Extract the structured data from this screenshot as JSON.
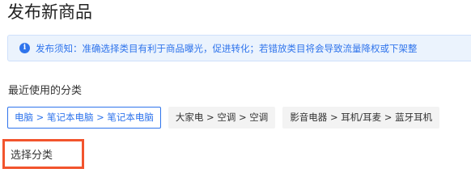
{
  "page": {
    "title": "发布新商品"
  },
  "notice": {
    "icon": "info-icon",
    "icon_glyph": "i",
    "text": "发布须知：准确选择类目有利于商品曝光，促进转化；若错放类目将会导致流量降权或下架整"
  },
  "recent": {
    "label": "最近使用的分类",
    "items": [
      {
        "label": "电脑 > 笔记本电脑 > 笔记本电脑",
        "selected": true
      },
      {
        "label": "大家电 > 空调 > 空调",
        "selected": false
      },
      {
        "label": "影音电器 > 耳机/耳麦 > 蓝牙耳机",
        "selected": false
      }
    ]
  },
  "select_category": {
    "label": "选择分类",
    "highlight_color": "#f2542d"
  },
  "colors": {
    "accent": "#2f74ec",
    "notice_bg": "#ebf3fd",
    "chip_bg": "#f3f3f3"
  }
}
